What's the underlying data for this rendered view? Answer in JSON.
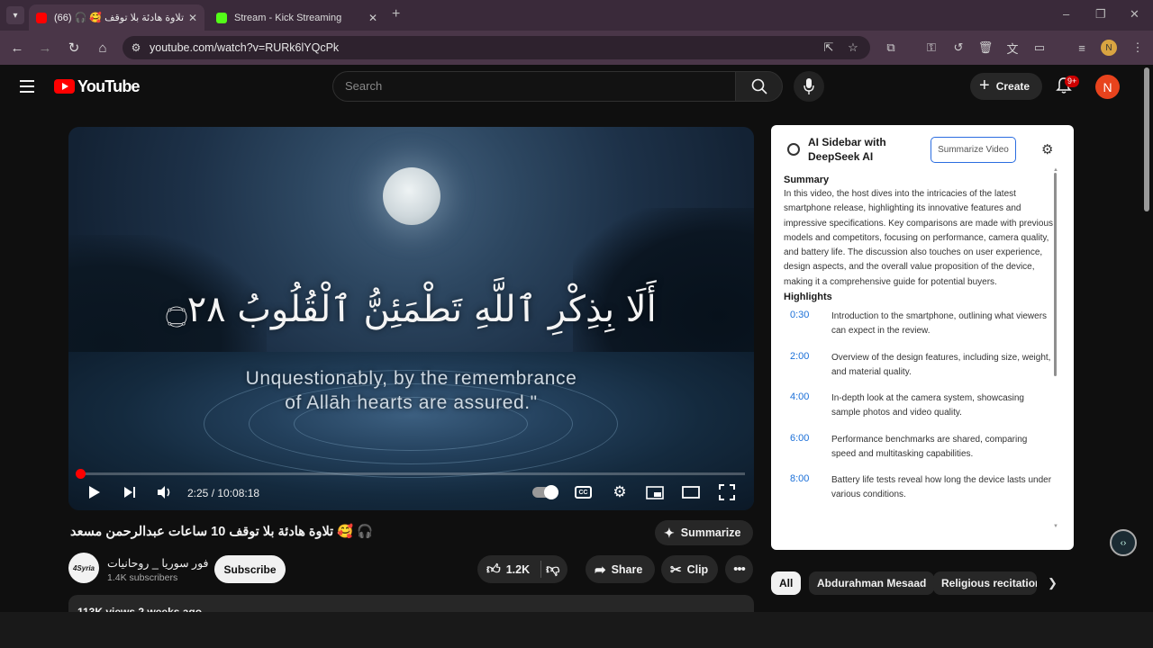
{
  "browser": {
    "tabs": [
      {
        "title": "تلاوة هادئة بلا توقف 🥰 🎧 (66)",
        "active": true
      },
      {
        "title": "Stream - Kick Streaming",
        "active": false
      }
    ],
    "url": "youtube.com/watch?v=RURk6lYQcPk",
    "profile_initial": "N"
  },
  "youtube": {
    "logo_text": "YouTube",
    "search_placeholder": "Search",
    "create_label": "Create",
    "notification_badge": "9+",
    "avatar_initial": "N"
  },
  "player": {
    "verse_arabic": "أَلَا بِذِكْرِ ٱللَّهِ تَطْمَئِنُّ ٱلْقُلُوبُ ۝٢٨",
    "translation_line1": "Unquestionably, by the remembrance",
    "translation_line2": "of Allāh hearts are assured.\"",
    "time": "2:25 / 10:08:18",
    "progress_fraction": 0.004
  },
  "video": {
    "title": "🎧 🥰 تلاوة هادئة بلا توقف 10 ساعات عبدالرحمن مسعد",
    "summarize_label": "Summarize",
    "channel_name": "فور سوريا _ روحانيات",
    "channel_logo_text": "4Syria",
    "subscribers": "1.4K subscribers",
    "subscribe_label": "Subscribe",
    "likes": "1.2K",
    "share_label": "Share",
    "clip_label": "Clip",
    "meta": "113K views  2 weeks ago"
  },
  "ai_sidebar": {
    "title": "AI Sidebar with DeepSeek AI",
    "summarize_button": "Summarize Video",
    "summary_heading": "Summary",
    "summary_text": "In this video, the host dives into the intricacies of the latest smartphone release, highlighting its innovative features and impressive specifications. Key comparisons are made with previous models and competitors, focusing on performance, camera quality, and battery life. The discussion also touches on user experience, design aspects, and the overall value proposition of the device, making it a comprehensive guide for potential buyers.",
    "highlights_heading": "Highlights",
    "highlights": [
      {
        "time": "0:30",
        "text": "Introduction to the smartphone, outlining what viewers can expect in the review."
      },
      {
        "time": "2:00",
        "text": "Overview of the design features, including size, weight, and material quality."
      },
      {
        "time": "4:00",
        "text": "In-depth look at the camera system, showcasing sample photos and video quality."
      },
      {
        "time": "6:00",
        "text": "Performance benchmarks are shared, comparing speed and multitasking capabilities."
      },
      {
        "time": "8:00",
        "text": "Battery life tests reveal how long the device lasts under various conditions."
      }
    ]
  },
  "chips": [
    "All",
    "Abdurahman Mesaad",
    "Religious recitation"
  ],
  "colors": {
    "accent_red": "#ff0000",
    "link_blue": "#1a6fd8",
    "avatar_orange": "#e8431d"
  }
}
